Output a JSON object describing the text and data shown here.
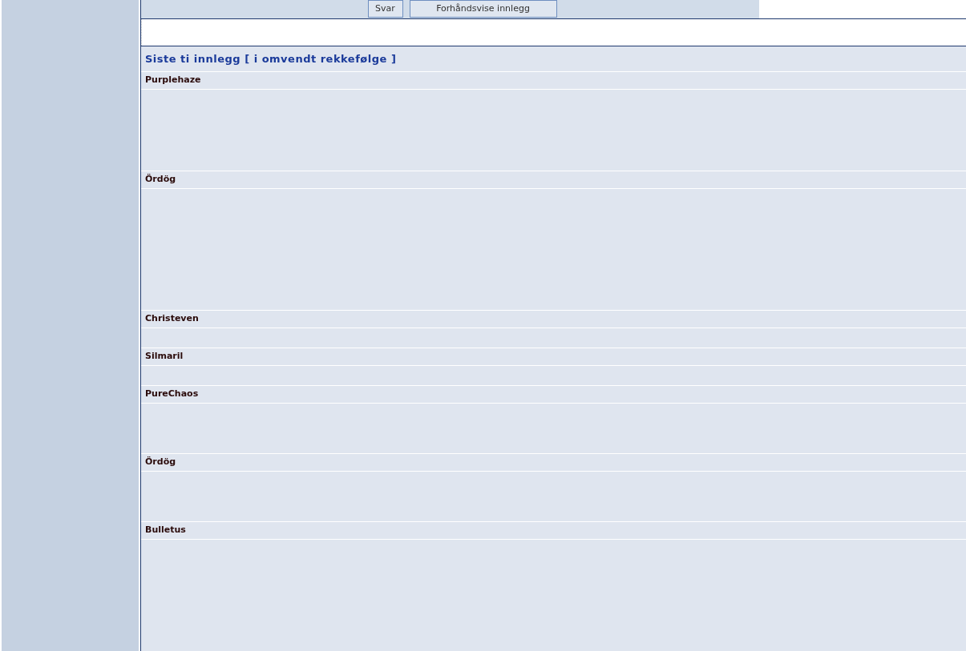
{
  "toolbar": {
    "buttons": [
      "Svar",
      "Forhåndsvise innlegg"
    ]
  },
  "recent_posts": {
    "title": "Siste ti innlegg [ i omvendt rekkefølge ]",
    "posts": [
      {
        "author": "Purplehaze"
      },
      {
        "author": "Ördög"
      },
      {
        "author": "Christeven"
      },
      {
        "author": "Silmaril"
      },
      {
        "author": "PureChaos"
      },
      {
        "author": "Ördög"
      },
      {
        "author": "Bulletus"
      }
    ]
  }
}
